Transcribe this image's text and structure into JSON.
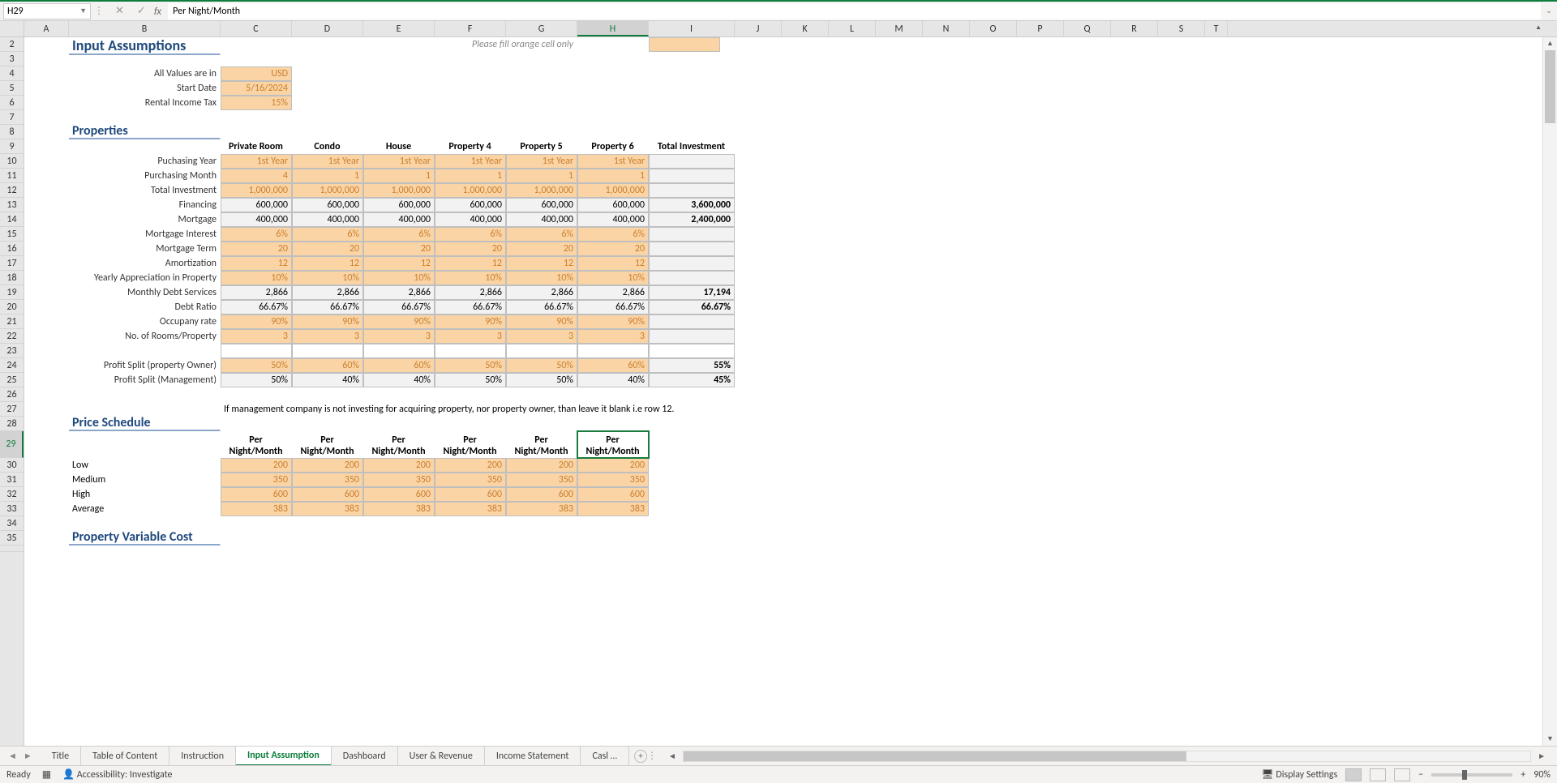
{
  "nameBox": "H29",
  "formulaValue": "Per Night/Month",
  "columns": [
    "A",
    "B",
    "C",
    "D",
    "E",
    "F",
    "G",
    "H",
    "I",
    "J",
    "K",
    "L",
    "M",
    "N",
    "O",
    "P",
    "Q",
    "R",
    "S",
    "T"
  ],
  "activeCol": "H",
  "rowNumbers": [
    2,
    3,
    4,
    5,
    6,
    7,
    8,
    9,
    10,
    11,
    12,
    13,
    14,
    15,
    16,
    17,
    18,
    19,
    20,
    21,
    22,
    23,
    24,
    25,
    26,
    27,
    28,
    29,
    30,
    31,
    32,
    33,
    34,
    35
  ],
  "activeRow": 29,
  "headings": {
    "inputAssumptions": "Input Assumptions",
    "properties": "Properties",
    "priceSchedule": "Price Schedule",
    "propertyVarCost": "Property Variable Cost"
  },
  "notes": {
    "fillOrange": "Please fill orange cell only",
    "mgmtNote": "If management company is not investing for acquiring property, nor property owner, than leave it blank i.e row 12."
  },
  "assumptions": {
    "labels": {
      "valuesIn": "All Values are in",
      "startDate": "Start Date",
      "tax": "Rental Income Tax"
    },
    "values": {
      "valuesIn": "USD",
      "startDate": "5/16/2024",
      "tax": "15%"
    }
  },
  "propertyCols": [
    "Private Room",
    "Condo",
    "House",
    "Property 4",
    "Property 5",
    "Property 6",
    "Total Investment"
  ],
  "propertyRows": {
    "puchasingYear": {
      "label": "Puchasing Year",
      "vals": [
        "1st Year",
        "1st Year",
        "1st Year",
        "1st Year",
        "1st Year",
        "1st Year"
      ],
      "total": "",
      "textCol": true
    },
    "purchasingMonth": {
      "label": "Purchasing Month",
      "vals": [
        "4",
        "1",
        "1",
        "1",
        "1",
        "1"
      ],
      "total": ""
    },
    "totalInvestment": {
      "label": "Total Investment",
      "vals": [
        "1,000,000",
        "1,000,000",
        "1,000,000",
        "1,000,000",
        "1,000,000",
        "1,000,000"
      ],
      "total": ""
    },
    "financing": {
      "label": "Financing",
      "vals": [
        "600,000",
        "600,000",
        "600,000",
        "600,000",
        "600,000",
        "600,000"
      ],
      "total": "3,600,000"
    },
    "mortgage": {
      "label": "Mortgage",
      "vals": [
        "400,000",
        "400,000",
        "400,000",
        "400,000",
        "400,000",
        "400,000"
      ],
      "total": "2,400,000"
    },
    "mortgageInterest": {
      "label": "Mortgage Interest",
      "vals": [
        "6%",
        "6%",
        "6%",
        "6%",
        "6%",
        "6%"
      ],
      "total": ""
    },
    "mortgageTerm": {
      "label": "Mortgage Term",
      "vals": [
        "20",
        "20",
        "20",
        "20",
        "20",
        "20"
      ],
      "total": ""
    },
    "amortization": {
      "label": "Amortization",
      "vals": [
        "12",
        "12",
        "12",
        "12",
        "12",
        "12"
      ],
      "total": ""
    },
    "appreciation": {
      "label": "Yearly Appreciation in Property",
      "vals": [
        "10%",
        "10%",
        "10%",
        "10%",
        "10%",
        "10%"
      ],
      "total": ""
    },
    "monthlyDebt": {
      "label": "Monthly Debt Services",
      "vals": [
        "2,866",
        "2,866",
        "2,866",
        "2,866",
        "2,866",
        "2,866"
      ],
      "total": "17,194"
    },
    "debtRatio": {
      "label": "Debt Ratio",
      "vals": [
        "66.67%",
        "66.67%",
        "66.67%",
        "66.67%",
        "66.67%",
        "66.67%"
      ],
      "total": "66.67%"
    },
    "occupancy": {
      "label": "Occupany rate",
      "vals": [
        "90%",
        "90%",
        "90%",
        "90%",
        "90%",
        "90%"
      ],
      "total": ""
    },
    "rooms": {
      "label": "No. of Rooms/Property",
      "vals": [
        "3",
        "3",
        "3",
        "3",
        "3",
        "3"
      ],
      "total": ""
    },
    "profitOwner": {
      "label": "Profit Split (property Owner)",
      "vals": [
        "50%",
        "60%",
        "60%",
        "50%",
        "50%",
        "60%"
      ],
      "total": "55%"
    },
    "profitMgmt": {
      "label": "Profit Split (Management)",
      "vals": [
        "50%",
        "40%",
        "40%",
        "50%",
        "50%",
        "40%"
      ],
      "total": "45%"
    }
  },
  "priceHeaders": [
    "Per Night/Month",
    "Per Night/Month",
    "Per Night/Month",
    "Per Night/Month",
    "Per Night/Month",
    "Per Night/Month"
  ],
  "priceHeadersL1": "Per",
  "priceHeadersL2": "Night/Month",
  "priceRows": {
    "low": {
      "label": "Low",
      "vals": [
        "200",
        "200",
        "200",
        "200",
        "200",
        "200"
      ]
    },
    "medium": {
      "label": "Medium",
      "vals": [
        "350",
        "350",
        "350",
        "350",
        "350",
        "350"
      ]
    },
    "high": {
      "label": "High",
      "vals": [
        "600",
        "600",
        "600",
        "600",
        "600",
        "600"
      ]
    },
    "average": {
      "label": "Average",
      "vals": [
        "383",
        "383",
        "383",
        "383",
        "383",
        "383"
      ]
    }
  },
  "sheetTabs": [
    "Title",
    "Table of Content",
    "Instruction",
    "Input Assumption",
    "Dashboard",
    "User & Revenue",
    "Income Statement",
    "Casl …"
  ],
  "activeSheet": "Input Assumption",
  "statusBar": {
    "ready": "Ready",
    "accessibility": "Accessibility: Investigate",
    "displaySettings": "Display Settings",
    "zoom": "90%"
  }
}
